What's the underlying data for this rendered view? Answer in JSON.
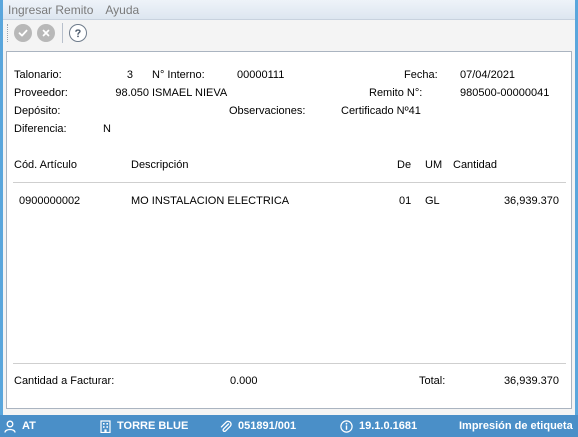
{
  "menu": {
    "items": [
      "Ingresar Remito",
      "Ayuda"
    ]
  },
  "toolbar": {
    "icons": [
      "check-icon",
      "cancel-icon",
      "help-icon"
    ]
  },
  "header": {
    "talonario_label": "Talonario:",
    "talonario_value": "3",
    "interno_label": "N° Interno:",
    "interno_value": "00000111",
    "fecha_label": "Fecha:",
    "fecha_value": "07/04/2021",
    "proveedor_label": "Proveedor:",
    "proveedor_code": "98.050",
    "proveedor_name": "ISMAEL NIEVA",
    "remito_label": "Remito N°:",
    "remito_value": "980500-00000041",
    "deposito_label": "Depósito:",
    "observaciones_label": "Observaciones:",
    "observaciones_value": "Certificado Nº41",
    "diferencia_label": "Diferencia:",
    "diferencia_value": "N"
  },
  "table": {
    "columns": {
      "codigo": "Cód. Artículo",
      "descripcion": "Descripción",
      "de": "De",
      "um": "UM",
      "cantidad": "Cantidad"
    },
    "rows": [
      {
        "codigo": "0900000002",
        "descripcion": "MO INSTALACION ELECTRICA",
        "de": "01",
        "um": "GL",
        "cantidad": "36,939.370"
      }
    ]
  },
  "footer": {
    "cantidad_label": "Cantidad a Facturar:",
    "cantidad_value": "0.000",
    "total_label": "Total:",
    "total_value": "36,939.370"
  },
  "statusbar": {
    "user": "AT",
    "company": "TORRE BLUE",
    "license": "051891/001",
    "version": "19.1.0.1681",
    "message": "Impresión de etiqueta"
  },
  "colors": {
    "frame": "#5aa6dc",
    "statusbar": "#4a8fc8",
    "menu_text": "#7a7a7a"
  }
}
